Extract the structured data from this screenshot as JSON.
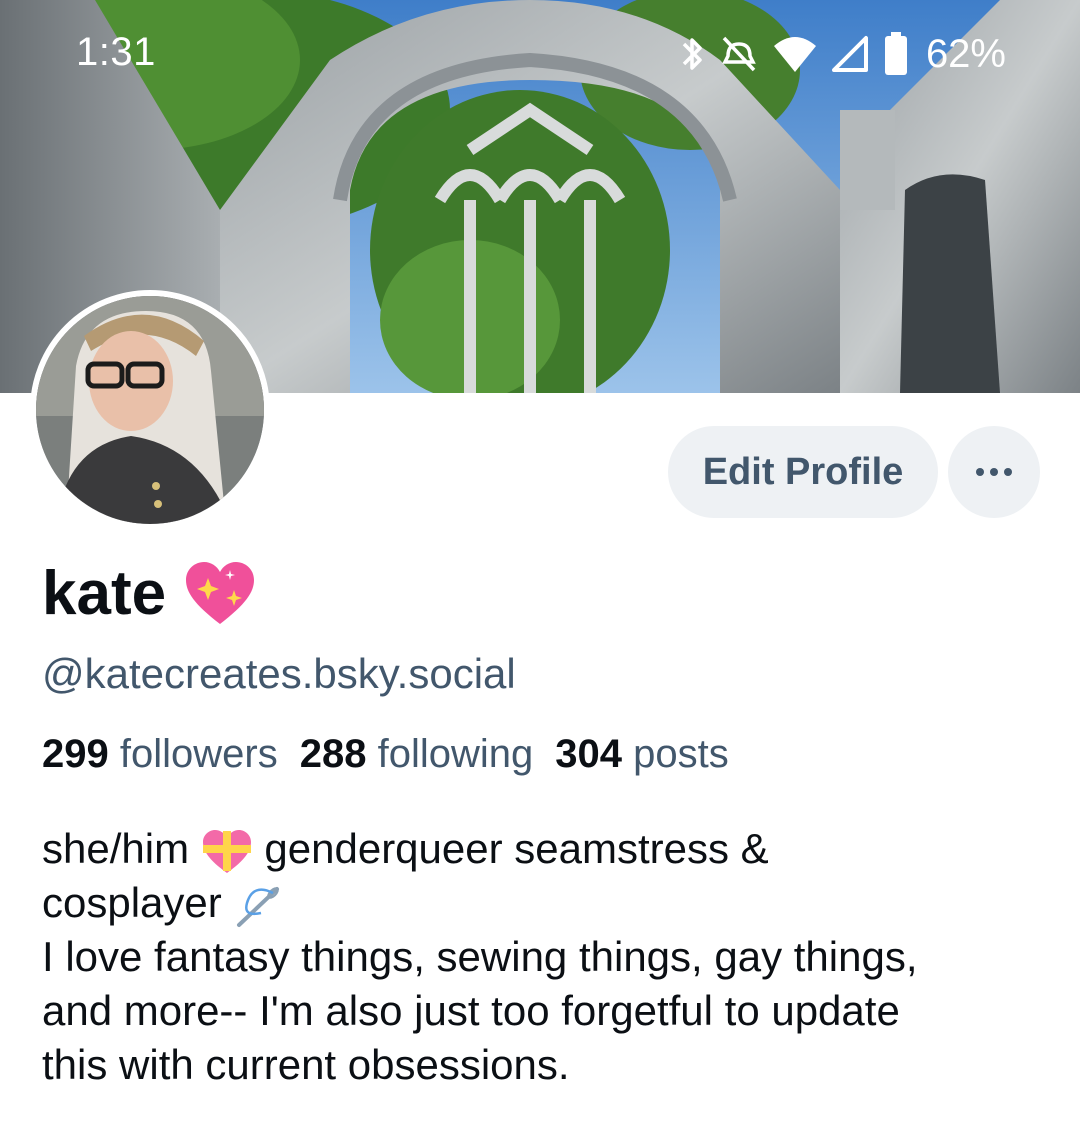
{
  "status_bar": {
    "time": "1:31",
    "battery_percent": "62%",
    "icons": [
      "bluetooth-icon",
      "mute-icon",
      "wifi-icon",
      "signal-icon",
      "battery-icon"
    ]
  },
  "profile": {
    "display_name": "kate",
    "name_emoji": "sparkling-heart-icon",
    "handle": "@katecreates.bsky.social",
    "edit_button_label": "Edit Profile",
    "more_button_icon": "more-options-icon",
    "stats": {
      "followers_count": "299",
      "followers_label": "followers",
      "following_count": "288",
      "following_label": "following",
      "posts_count": "304",
      "posts_label": "posts"
    },
    "bio": {
      "line1_a": "she/him",
      "line1_b": "genderqueer seamstress &",
      "line2": "cosplayer",
      "line3": "I love fantasy things, sewing things, gay things,",
      "line4": "and more-- I'm also just too forgetful to update",
      "line5": "this with current obsessions."
    }
  },
  "colors": {
    "text_primary": "#0b0f14",
    "text_secondary": "#42576c",
    "button_bg": "#eef1f4",
    "heart_pink": "#f0509a"
  }
}
